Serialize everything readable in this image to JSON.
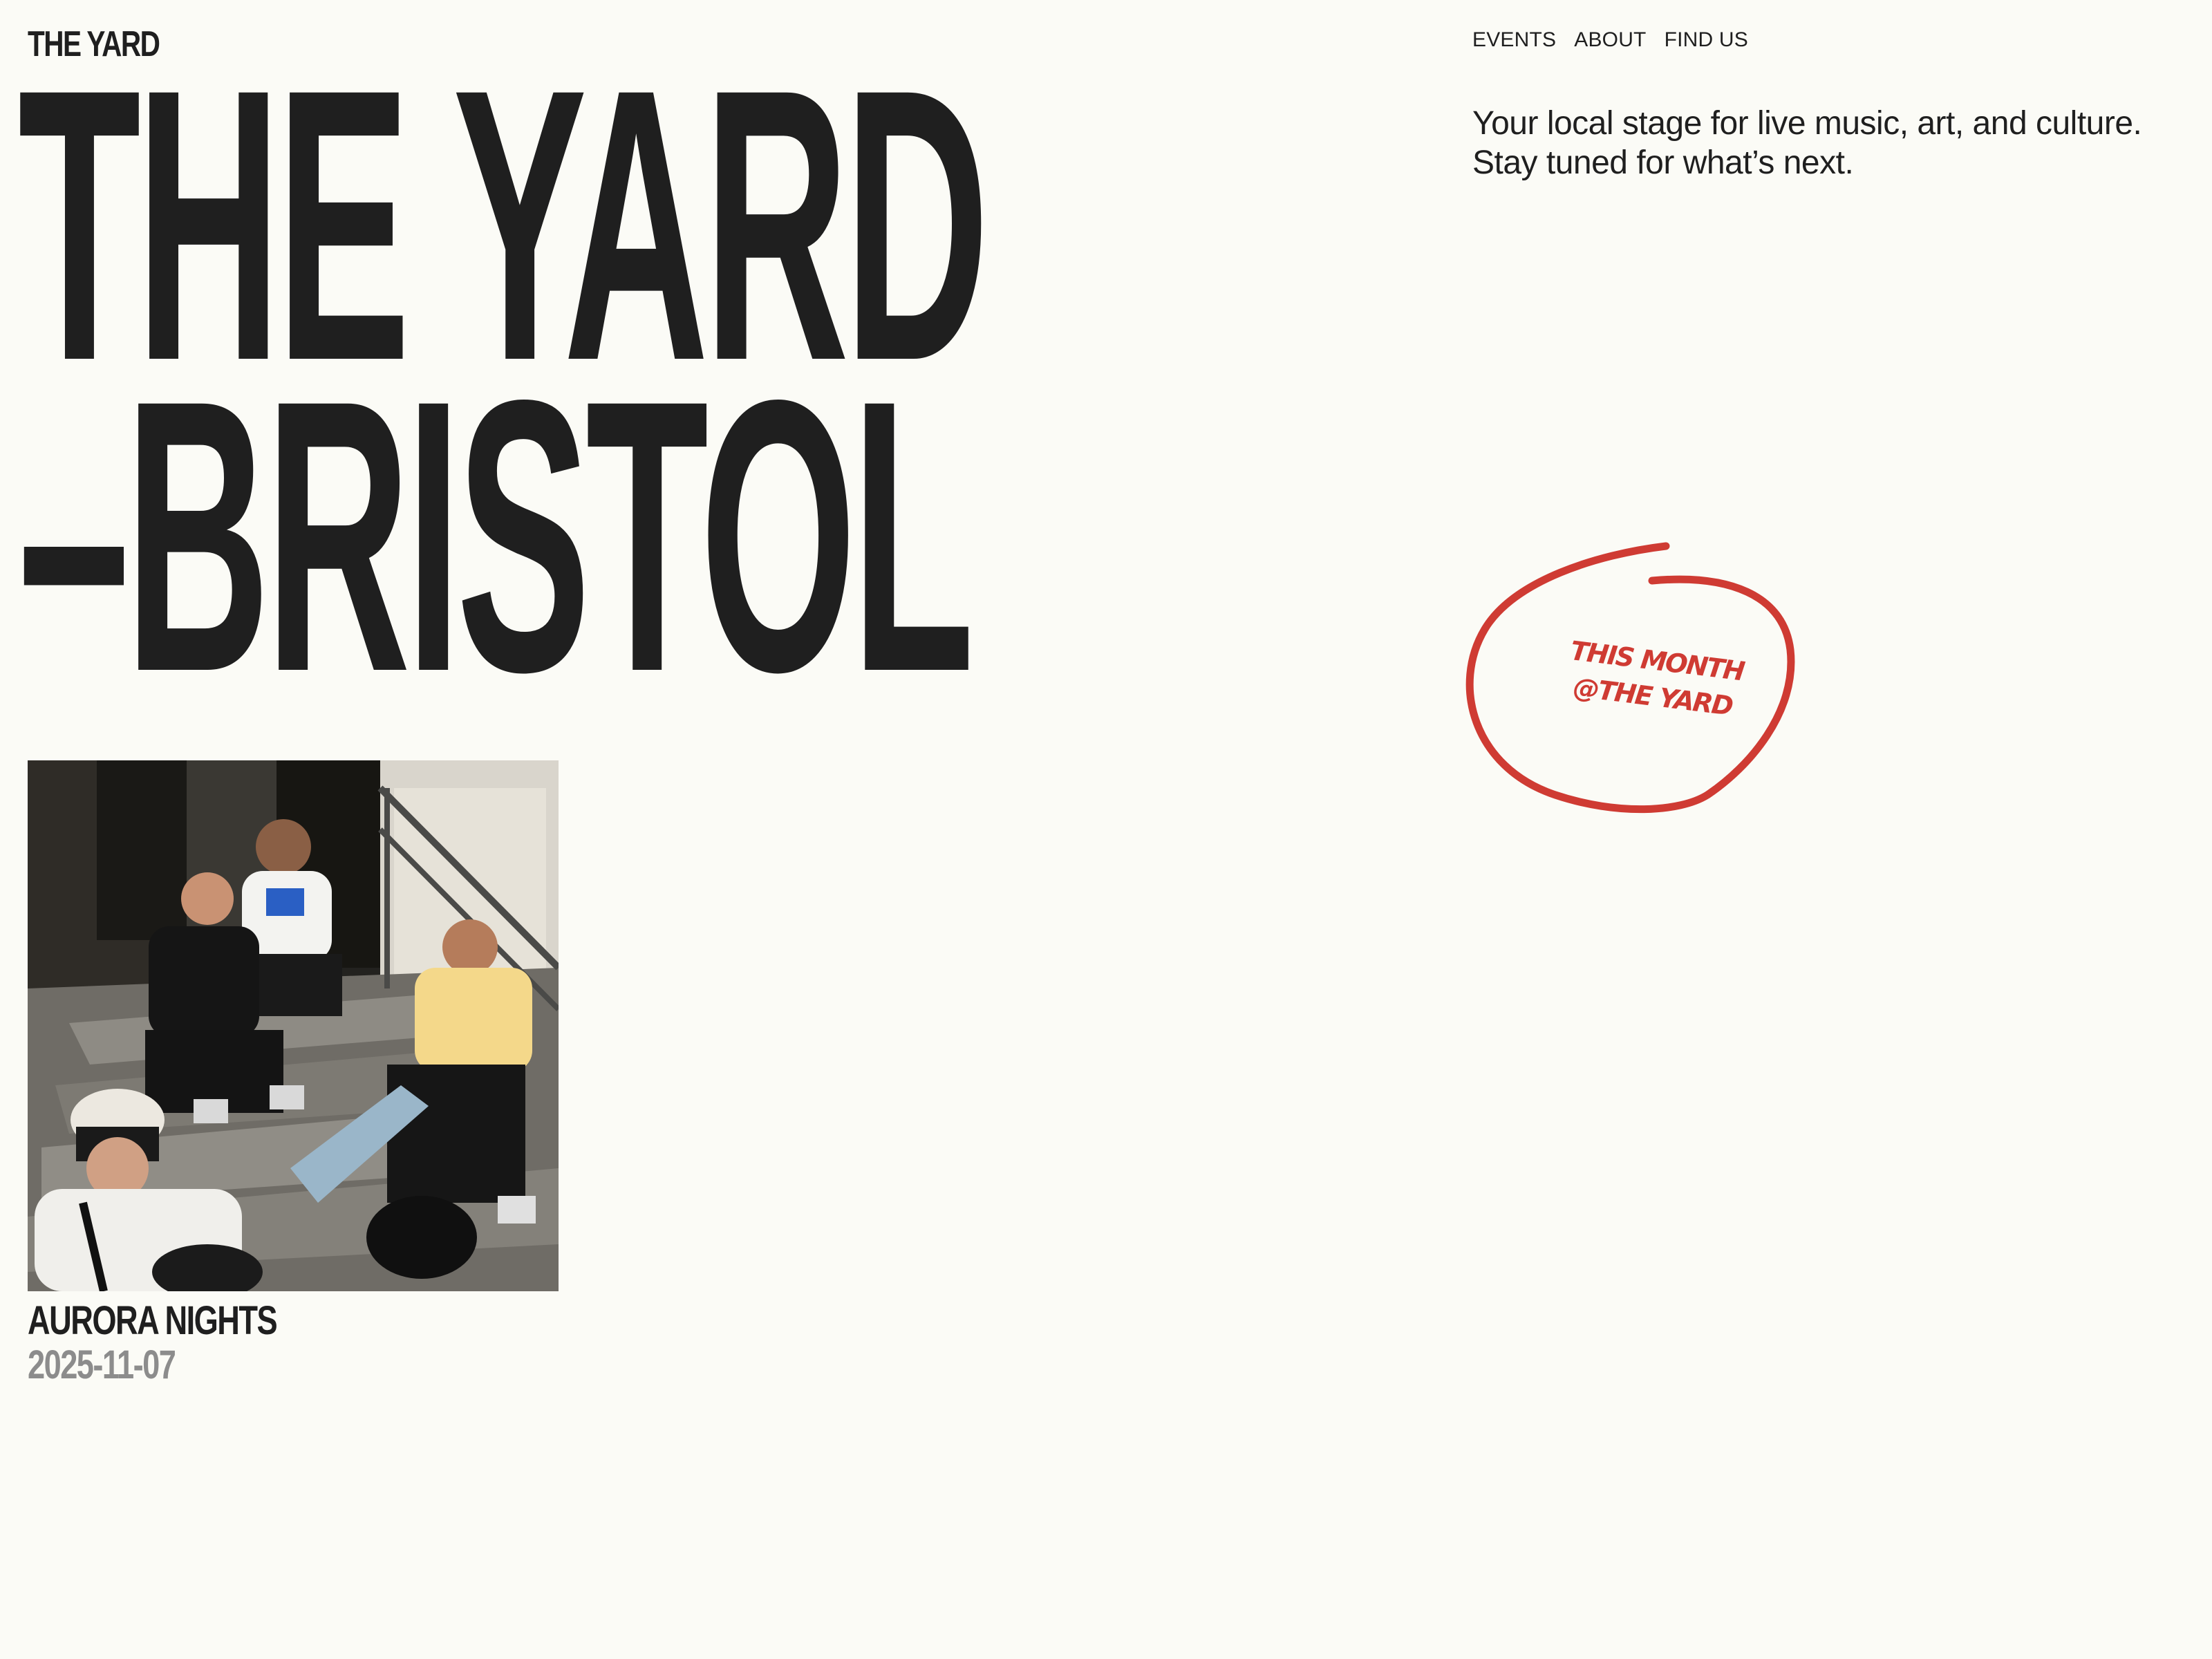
{
  "header": {
    "logo": "THE YARD",
    "nav": [
      "EVENTS",
      "ABOUT",
      "FIND US"
    ]
  },
  "intro": {
    "tagline_line1": "Your local stage for live music, art, and culture.",
    "tagline_line2": "Stay tuned for what’s next."
  },
  "hero": {
    "line1": "THE YARD",
    "line2": "–BRISTOL"
  },
  "badge": {
    "line1": "THIS MONTH",
    "line2": "@THE YARD",
    "color": "#cf3b33"
  },
  "event": {
    "title": "AURORA NIGHTS",
    "date": "2025-11-07"
  },
  "colors": {
    "background": "#fbfbf6",
    "text": "#1f1f1f",
    "date": "#8c8c8c",
    "accent": "#cf3b33"
  }
}
